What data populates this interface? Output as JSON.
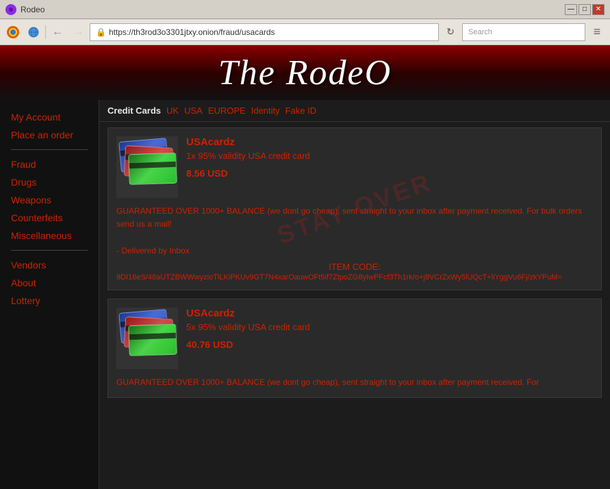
{
  "browser": {
    "title": "Rodeo",
    "url": "https://th3rod3o3301jtxy.onion/fraud/usacards",
    "search_placeholder": "Search",
    "window_controls": {
      "minimize": "—",
      "maximize": "□",
      "close": "✕"
    }
  },
  "site": {
    "title": "The RodeO"
  },
  "sidebar": {
    "items": [
      {
        "label": "My Account",
        "id": "my-account"
      },
      {
        "label": "Place an order",
        "id": "place-order"
      },
      {
        "label": "Fraud",
        "id": "fraud"
      },
      {
        "label": "Drugs",
        "id": "drugs"
      },
      {
        "label": "Weapons",
        "id": "weapons"
      },
      {
        "label": "Counterfeits",
        "id": "counterfeits"
      },
      {
        "label": "Miscellaneous",
        "id": "miscellaneous"
      },
      {
        "label": "Vendors",
        "id": "vendors"
      },
      {
        "label": "About",
        "id": "about"
      },
      {
        "label": "Lottery",
        "id": "lottery"
      }
    ]
  },
  "tabs": {
    "items": [
      {
        "label": "Credit Cards",
        "id": "credit-cards",
        "active": true
      },
      {
        "label": "UK",
        "id": "uk",
        "active": false
      },
      {
        "label": "USA",
        "id": "usa",
        "active": false
      },
      {
        "label": "EUROPE",
        "id": "europe",
        "active": false
      },
      {
        "label": "Identity",
        "id": "identity",
        "active": false
      },
      {
        "label": "Fake ID",
        "id": "fake-id",
        "active": false
      }
    ]
  },
  "products": [
    {
      "id": "product-1",
      "name": "USAcardz",
      "description": "1x 95% validity USA credit card",
      "price": "8.56 USD",
      "body": "GUARANTEED OVER 1000+ BALANCE (we dont go cheap), sent straight to your inbox after payment received. For bulk orders send us a mail!",
      "delivery": "- Delivered by Inbox",
      "item_code_label": "ITEM CODE:",
      "item_code": "9DI16eS/48aUTZBWWwyzioTlLKiPKUv9GT7N4xarOauwOFt5if7ZtpoZG8yIwPFcf3Th1rk/o+j8VCrZxWy5lUQcT+liYggVu6Fj/zkYPuM=",
      "watermark": "STAY OVER"
    },
    {
      "id": "product-2",
      "name": "USAcardz",
      "description": "5x 95% validity USA credit card",
      "price": "40.76 USD",
      "body": "GUARANTEED OVER 1000+ BALANCE (we dont go cheap), sent straight to your inbox after payment received. For",
      "delivery": "",
      "item_code_label": "",
      "item_code": "",
      "watermark": ""
    }
  ]
}
